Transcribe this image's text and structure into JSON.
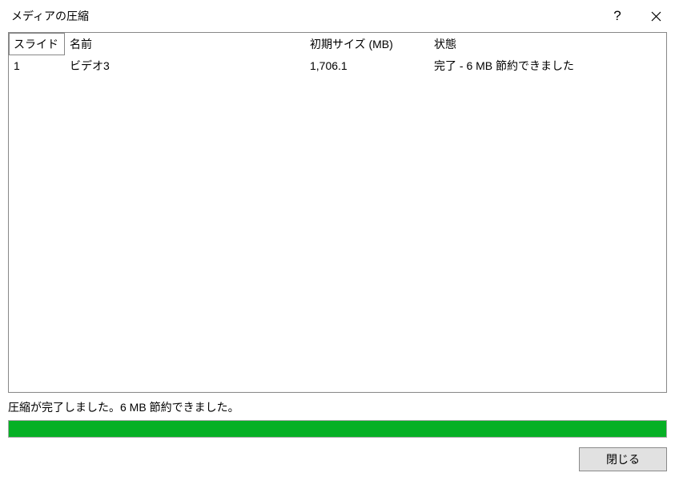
{
  "titlebar": {
    "title": "メディアの圧縮",
    "help_label": "?",
    "close_label": "×"
  },
  "table": {
    "headers": {
      "slide": "スライド",
      "name": "名前",
      "size": "初期サイズ (MB)",
      "state": "状態"
    },
    "rows": [
      {
        "slide": "1",
        "name": "ビデオ3",
        "size": "1,706.1",
        "state": "完了 - 6 MB 節約できました"
      }
    ]
  },
  "footer": {
    "status": "圧縮が完了しました。6 MB 節約できました。",
    "close_button": "閉じる"
  },
  "progress": {
    "percent": 100
  }
}
